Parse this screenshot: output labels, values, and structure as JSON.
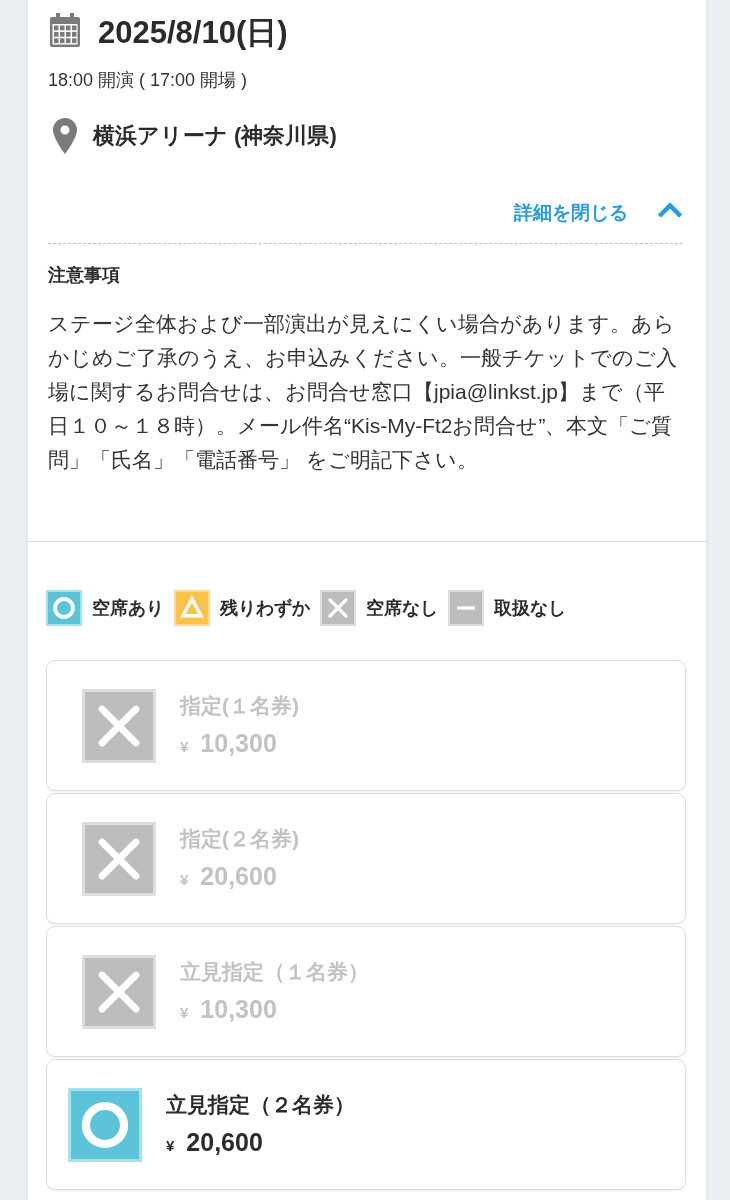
{
  "event": {
    "date": "2025/8/10(日)",
    "times": "18:00 開演 ( 17:00 開場 )",
    "venue": "横浜アリーナ (神奈川県)",
    "details_toggle": {
      "label": "詳細を閉じる",
      "expanded": true
    }
  },
  "details": {
    "title": "注意事項",
    "body": "ステージ全体および一部演出が見えにくい場合があります。あらかじめご了承のうえ、お申込みください。一般チケットでのご入場に関するお問合せは、お問合せ窓口【jpia@linkst.jp】まで（平日１０～１８時）。メール件名“Kis-My-Ft2お問合せ”、本文「ご質問」「氏名」「電話番号」 をご明記下さい。"
  },
  "legend": [
    {
      "kind": "available",
      "label": "空席あり"
    },
    {
      "kind": "few",
      "label": "残りわずか"
    },
    {
      "kind": "soldout",
      "label": "空席なし"
    },
    {
      "kind": "none",
      "label": "取扱なし"
    }
  ],
  "tickets": [
    {
      "kind": "soldout",
      "name": "指定(１名券)",
      "currency": "¥",
      "price": "10,300"
    },
    {
      "kind": "soldout",
      "name": "指定(２名券)",
      "currency": "¥",
      "price": "20,600"
    },
    {
      "kind": "soldout",
      "name": "立見指定（１名券）",
      "currency": "¥",
      "price": "10,300"
    },
    {
      "kind": "available",
      "name": "立見指定（２名券）",
      "currency": "¥",
      "price": "20,600"
    }
  ]
}
